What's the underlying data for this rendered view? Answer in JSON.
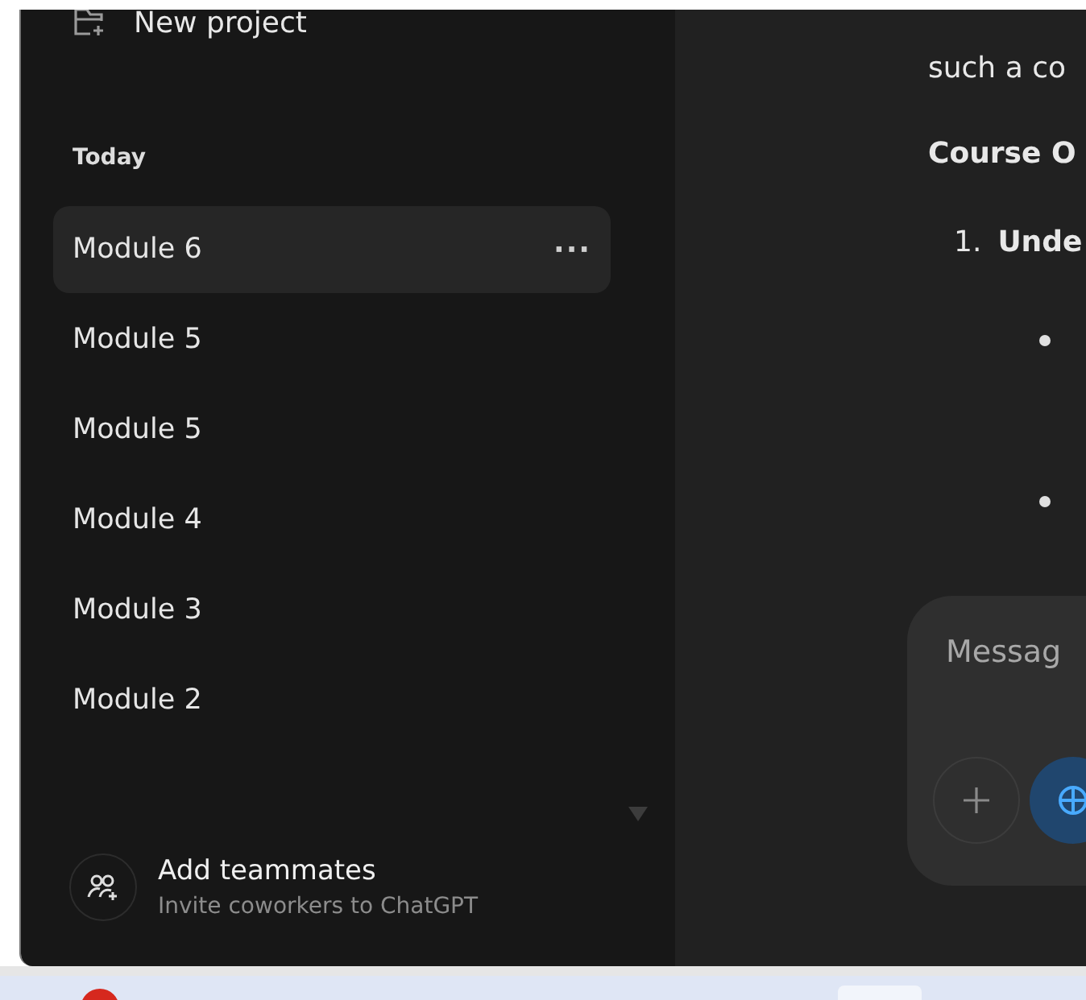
{
  "sidebar": {
    "new_project": "New project",
    "section": "Today",
    "items": [
      {
        "label": "Module 6",
        "selected": true
      },
      {
        "label": "Module 5",
        "selected": false
      },
      {
        "label": "Module 5",
        "selected": false
      },
      {
        "label": "Module 4",
        "selected": false
      },
      {
        "label": "Module 3",
        "selected": false
      },
      {
        "label": "Module 2",
        "selected": false
      }
    ],
    "more": "···",
    "add_teammates": {
      "title": "Add teammates",
      "subtitle": "Invite coworkers to ChatGPT"
    }
  },
  "chat": {
    "paragraph": "such a co",
    "heading": "Course O",
    "list_number": "1.",
    "list_item": "Unde"
  },
  "composer": {
    "placeholder": "Messag"
  }
}
